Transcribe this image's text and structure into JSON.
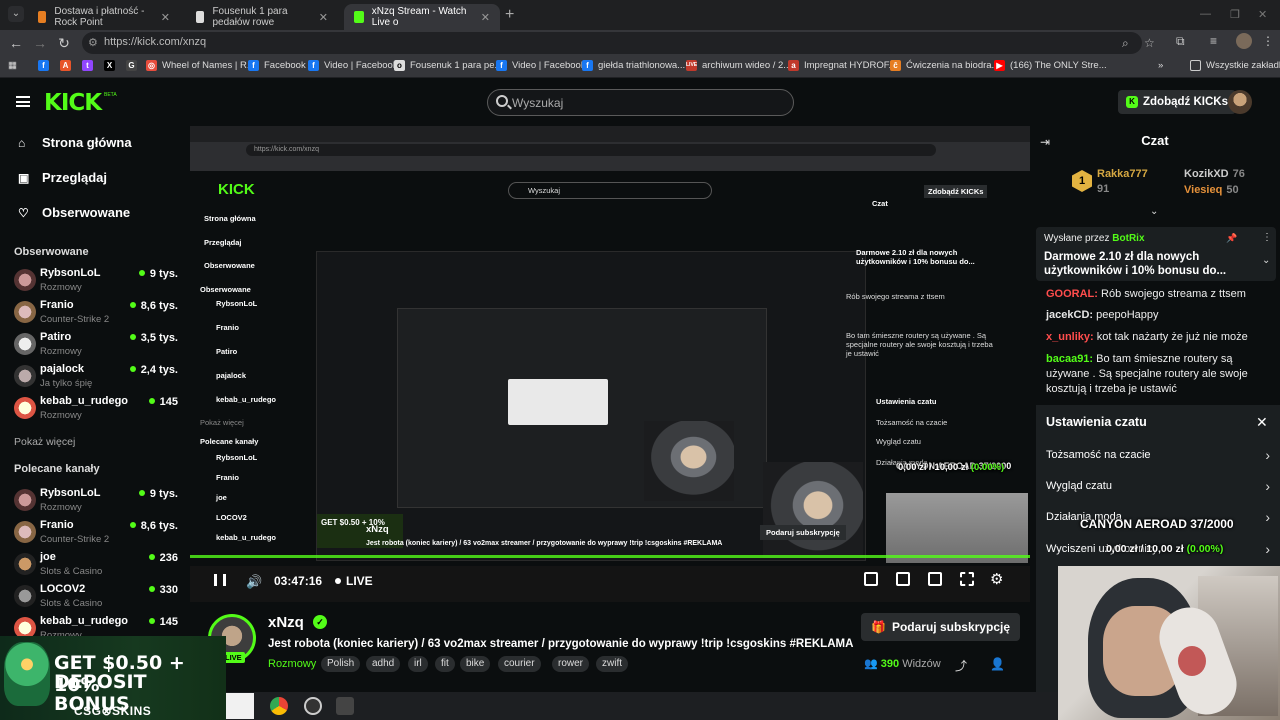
{
  "browser": {
    "tabs": [
      {
        "title": "Dostawa i płatność - Rock Point",
        "active": false
      },
      {
        "title": "Fousenuk 1 para pedałów rowe",
        "active": false
      },
      {
        "title": "xNzq Stream - Watch Live o",
        "active": true
      }
    ],
    "url": "https://kick.com/xnzq",
    "bookmarks": [
      "Wheel of Names | R...",
      "Facebook",
      "Video | Facebook",
      "Fousenuk 1 para pe...",
      "Video | Facebook",
      "giełda triathlonowa...",
      "archiwum wideo / 2...",
      "Impregnat HYDROF...",
      "Ćwiczenia na biodra...",
      "(166) The ONLY Stre..."
    ],
    "bookmarks_folder": "Wszystkie zakładki"
  },
  "header": {
    "logo": "KICK",
    "beta": "BETA",
    "search_placeholder": "Wyszukaj",
    "get_kicks": "Zdobądź KICKs"
  },
  "sidebar": {
    "nav": [
      {
        "label": "Strona główna",
        "icon": "home-icon"
      },
      {
        "label": "Przeglądaj",
        "icon": "browse-icon"
      },
      {
        "label": "Obserwowane",
        "icon": "heart-icon"
      }
    ],
    "followed_title": "Obserwowane",
    "followed": [
      {
        "name": "RybsonLoL",
        "category": "Rozmowy",
        "viewers": "9 tys."
      },
      {
        "name": "Franio",
        "category": "Counter-Strike 2",
        "viewers": "8,6 tys."
      },
      {
        "name": "Patiro",
        "category": "Rozmowy",
        "viewers": "3,5 tys."
      },
      {
        "name": "pajalock",
        "category": "Ja tylko śpię",
        "viewers": "2,4 tys."
      },
      {
        "name": "kebab_u_rudego",
        "category": "Rozmowy",
        "viewers": "145"
      }
    ],
    "show_more": "Pokaż więcej",
    "recommended_title": "Polecane kanały",
    "recommended": [
      {
        "name": "RybsonLoL",
        "category": "Rozmowy",
        "viewers": "9 tys."
      },
      {
        "name": "Franio",
        "category": "Counter-Strike 2",
        "viewers": "8,6 tys."
      },
      {
        "name": "joe",
        "category": "Slots & Casino",
        "viewers": "236"
      },
      {
        "name": "LOCOV2",
        "category": "Slots & Casino",
        "viewers": "330"
      },
      {
        "name": "kebab_u_rudego",
        "category": "Rozmowy",
        "viewers": "145"
      }
    ]
  },
  "player": {
    "time": "03:47:16",
    "live": "LIVE",
    "overlay_title": "CANYON AEROAD 37/2000",
    "overlay_values": "0,00 zł / 10,00 zł",
    "overlay_percent": "(0.00%)"
  },
  "stream": {
    "streamer": "xNzq",
    "live_badge": "LIVE",
    "title": "Jest robota (koniec kariery) / 63 vo2max streamer / przygotowanie do wyprawy !trip !csgoskins #REKLAMA",
    "category": "Rozmowy",
    "tags": [
      "Polish",
      "adhd",
      "irl",
      "fit",
      "bike",
      "courier",
      "rower",
      "zwift"
    ],
    "subscribe": "Podaruj subskrypcję",
    "viewers": "390",
    "viewers_label": "Widzów"
  },
  "chat": {
    "title": "Czat",
    "leaderboard": [
      {
        "name": "Rakka777",
        "value": "91"
      },
      {
        "name": "KozikXD",
        "value": "76"
      },
      {
        "name": "Viesieq",
        "value": "50"
      }
    ],
    "pinned_by_label": "Wysłane przez",
    "pinned_by": "BotRix",
    "pinned_message": "Darmowe 2.10 zł dla nowych użytkowników i 10% bonusu do...",
    "messages": [
      {
        "user": "GOORAL:",
        "text": "Rób swojego streama z ttsem",
        "color": "#ff4d4d"
      },
      {
        "user": "jacekCD:",
        "text": "peepoHappy",
        "color": "#e6e6e6"
      },
      {
        "user": "x_unliky:",
        "text": "kot tak nażarty że już nie może",
        "color": "#ff4d4d"
      },
      {
        "user": "bacaa91:",
        "text": "Bo tam śmieszne routery są używane . Są specjalne routery ale swoje kosztują i trzeba je ustawić",
        "color": "#53fc18"
      }
    ],
    "settings": {
      "title": "Ustawienia czatu",
      "rows": [
        "Tożsamość na czacie",
        "Wygląd czatu",
        "Działania moda",
        "Wyciszeni użytkownicy"
      ]
    }
  },
  "promo": {
    "line1": "GET $0.50 + 10%",
    "line2": "DEPOSIT BONUS",
    "brand": "CSG⊗SKINS"
  },
  "colors": {
    "accent": "#53fc18",
    "background": "#0b0e0f",
    "panel": "#1b1f21"
  }
}
